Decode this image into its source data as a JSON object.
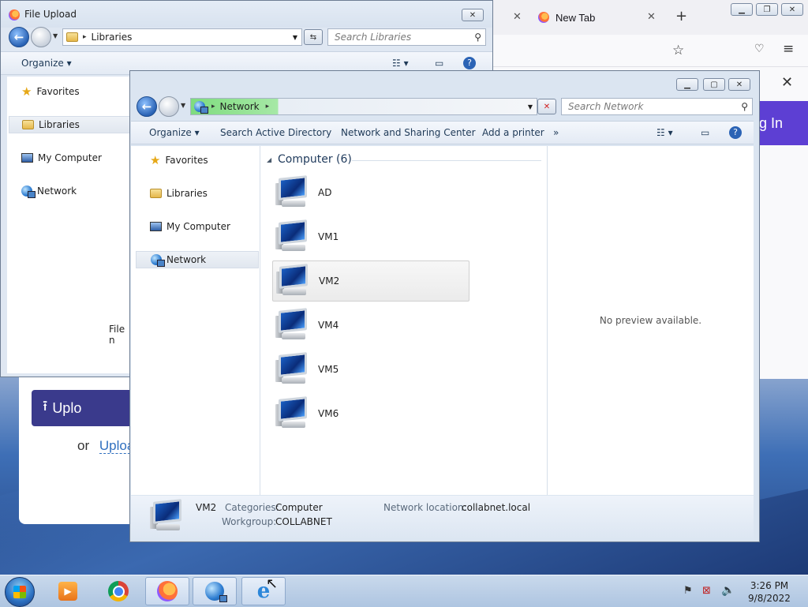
{
  "browser": {
    "tab_label": "New Tab",
    "login_label": "og In",
    "upload_button_label": "Uplo",
    "or_text": "or",
    "upload_link_text": "Uploa"
  },
  "file_upload_dialog": {
    "title": "File Upload",
    "address": "Libraries",
    "search_placeholder": "Search Libraries",
    "organize_label": "Organize",
    "nav_items": [
      "Favorites",
      "Libraries",
      "My Computer",
      "Network"
    ],
    "partial_text": "File n"
  },
  "network_window": {
    "address": "Network",
    "search_placeholder": "Search Network",
    "commands": {
      "organize": "Organize",
      "search_ad": "Search Active Directory",
      "sharing_center": "Network and Sharing Center",
      "add_printer": "Add a printer",
      "more": "»"
    },
    "nav_items": [
      "Favorites",
      "Libraries",
      "My Computer",
      "Network"
    ],
    "group_header": "Computer (6)",
    "computers": [
      "AD",
      "VM1",
      "VM2",
      "VM4",
      "VM5",
      "VM6"
    ],
    "selected_computer": "VM2",
    "preview_text": "No preview available.",
    "details": {
      "name": "VM2",
      "categories_label": "Categories:",
      "categories_value": "Computer",
      "workgroup_label": "Workgroup:",
      "workgroup_value": "COLLABNET",
      "network_location_label": "Network location:",
      "network_location_value": "collabnet.local"
    }
  },
  "taskbar": {
    "time": "3:26 PM",
    "date": "9/8/2022"
  }
}
